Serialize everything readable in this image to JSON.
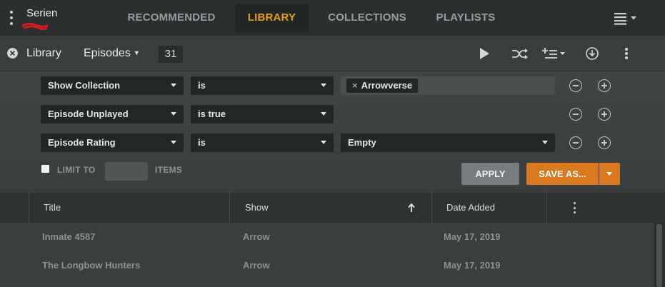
{
  "topbar": {
    "server_name": "Serien",
    "tabs": [
      {
        "label": "RECOMMENDED",
        "active": false
      },
      {
        "label": "LIBRARY",
        "active": true
      },
      {
        "label": "COLLECTIONS",
        "active": false
      },
      {
        "label": "PLAYLISTS",
        "active": false
      }
    ],
    "accent_color": "#e5a00d"
  },
  "libbar": {
    "title": "Library",
    "type_dropdown": "Episodes",
    "count": "31",
    "icons": [
      "close-icon",
      "play-icon",
      "shuffle-icon",
      "add-to-queue-icon",
      "download-icon",
      "more-vertical-icon"
    ]
  },
  "filters": {
    "rows": [
      {
        "field": "Show Collection",
        "operator": "is",
        "value_tag": "Arrowverse"
      },
      {
        "field": "Episode Unplayed",
        "operator": "is true"
      },
      {
        "field": "Episode Rating",
        "operator": "is",
        "value": "Empty"
      }
    ],
    "limit_to_label": "LIMIT TO",
    "limit_items_label": "ITEMS",
    "limit_checked": false,
    "apply_label": "APPLY",
    "save_as_label": "SAVE AS...",
    "save_color": "#d9781f"
  },
  "table": {
    "columns": [
      "Title",
      "Show",
      "Date Added"
    ],
    "sorted_column": "Show",
    "sort_direction": "ascending",
    "rows": [
      {
        "title": "Inmate 4587",
        "show": "Arrow",
        "date_added": "May 17, 2019"
      },
      {
        "title": "The Longbow Hunters",
        "show": "Arrow",
        "date_added": "May 17, 2019"
      }
    ]
  }
}
